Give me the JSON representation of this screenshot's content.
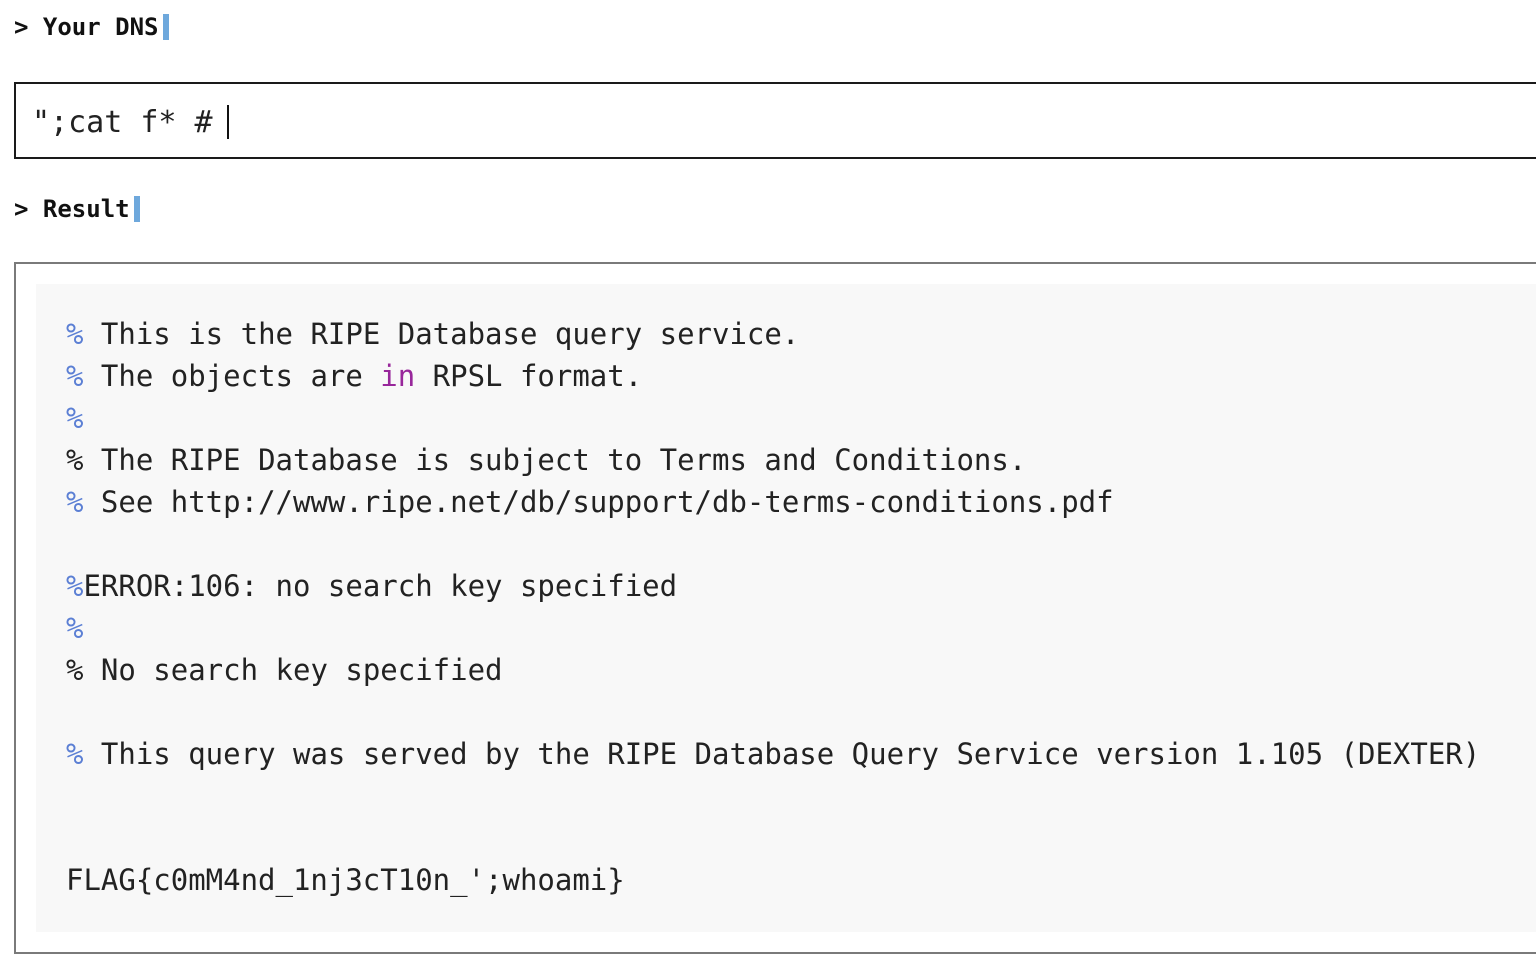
{
  "dns_section": {
    "heading": "> Your DNS",
    "input_value": "\";cat f* #"
  },
  "result_section": {
    "heading": "> Result",
    "lines": [
      {
        "prefix": "%",
        "prefix_color": "blue",
        "text": " This is the RIPE Database query service."
      },
      {
        "prefix": "%",
        "prefix_color": "blue",
        "text_before": " The objects are ",
        "keyword": "in",
        "text_after": " RPSL format."
      },
      {
        "prefix": "%",
        "prefix_color": "blue",
        "text": ""
      },
      {
        "prefix": "%",
        "prefix_color": "dark",
        "text": " The RIPE Database is subject to Terms and Conditions."
      },
      {
        "prefix": "%",
        "prefix_color": "blue",
        "text": " See http://www.ripe.net/db/support/db-terms-conditions.pdf"
      },
      {
        "prefix": "%",
        "prefix_color": "blue",
        "text": "ERROR:106: no search key specified"
      },
      {
        "prefix": "%",
        "prefix_color": "blue",
        "text": ""
      },
      {
        "prefix": "%",
        "prefix_color": "dark",
        "text": " No search key specified"
      },
      {
        "prefix": "%",
        "prefix_color": "blue",
        "text": " This query was served by the RIPE Database Query Service version 1.105 (DEXTER)"
      },
      {
        "prefix": "",
        "text": "FLAG{c0mM4nd_1nj3cT10n_';whoami}"
      }
    ]
  },
  "colors": {
    "caret_accent": "#6ea8dc",
    "percent_blue": "#5b7fd4",
    "keyword_purple": "#98279b",
    "code_background": "#f8f8f8"
  }
}
